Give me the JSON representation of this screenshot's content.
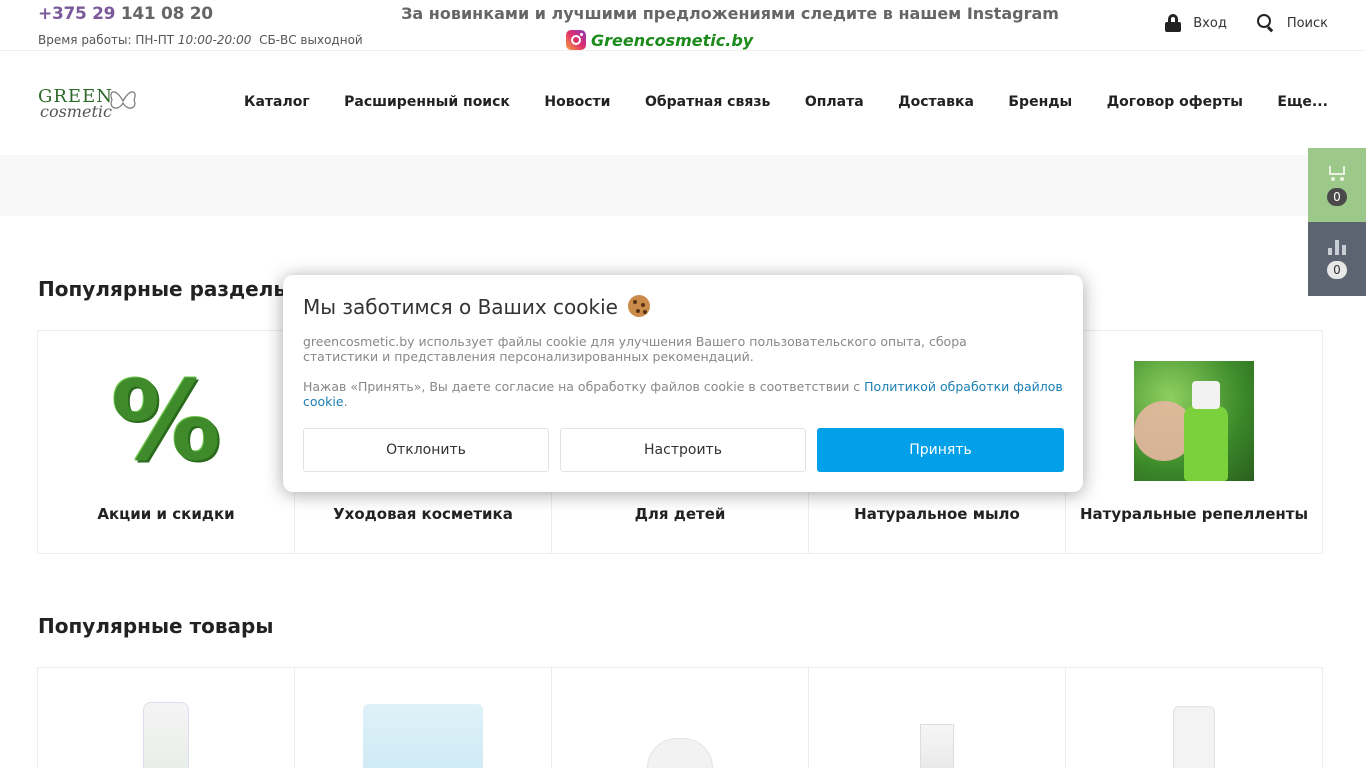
{
  "topbar": {
    "phone_code": "+375 29",
    "phone_number": "141 08 20",
    "hours_label": "Время работы: ПН-ПТ",
    "hours_weekday": "10:00-20:00",
    "hours_weekend": "СБ-ВС выходной",
    "promo": "За новинками и лучшими предложениями следите в нашем Instagram",
    "instagram_link": "Greencosmetic.by",
    "login_label": "Вход",
    "search_label": "Поиск"
  },
  "header": {
    "logo_top": "GREEN",
    "logo_bottom": "cosmetic",
    "nav": [
      "Каталог",
      "Расширенный поиск",
      "Новости",
      "Обратная связь",
      "Оплата",
      "Доставка",
      "Бренды",
      "Договор оферты",
      "Еще..."
    ]
  },
  "widgets": {
    "cart_count": "0",
    "compare_count": "0"
  },
  "popular_sections": {
    "title": "Популярные разделы",
    "items": [
      "Акции и скидки",
      "Уходовая косметика",
      "Для детей",
      "Натуральное мыло",
      "Натуральные репелленты"
    ]
  },
  "popular_products": {
    "title": "Популярные товары"
  },
  "cookie": {
    "title": "Мы заботимся о Ваших cookie",
    "text1": "greencosmetic.by использует файлы cookie для улучшения Вашего пользовательского опыта, сбора статистики и представления персонализированных рекомендаций.",
    "text2": "Нажав «Принять», Вы даете согласие на обработку файлов cookie в соответствии с",
    "policy_link": "Политикой обработки файлов cookie",
    "decline": "Отклонить",
    "configure": "Настроить",
    "accept": "Принять"
  },
  "colors": {
    "accent": "#02a0e8",
    "cart_bg": "#9cc98a",
    "compare_bg": "#5b6470",
    "instagram_green": "#1c8b1c"
  }
}
